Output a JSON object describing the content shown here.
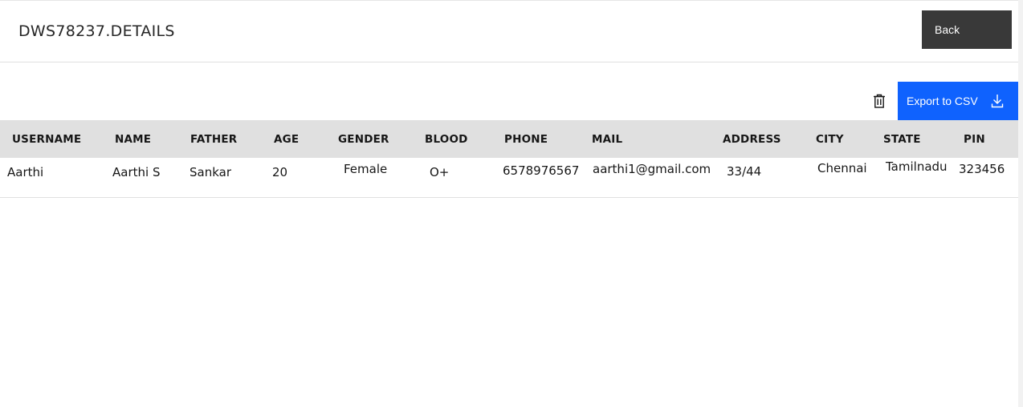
{
  "header": {
    "title": "DWS78237.DETAILS",
    "back_label": "Back"
  },
  "toolbar": {
    "delete_icon": "trash-icon",
    "export_label": "Export to CSV",
    "export_icon": "download-icon",
    "accent_color": "#0f62fe"
  },
  "table": {
    "columns": [
      "USERNAME",
      "NAME",
      "FATHER",
      "AGE",
      "GENDER",
      "BLOOD",
      "PHONE",
      "MAIL",
      "ADDRESS",
      "CITY",
      "STATE",
      "PIN"
    ],
    "rows": [
      [
        "Aarthi",
        "Aarthi S",
        "Sankar",
        "20",
        "Female",
        "O+",
        "6578976567",
        "aarthi1@gmail.com",
        "33/44",
        "Chennai",
        "Tamilnadu",
        "323456"
      ]
    ]
  }
}
